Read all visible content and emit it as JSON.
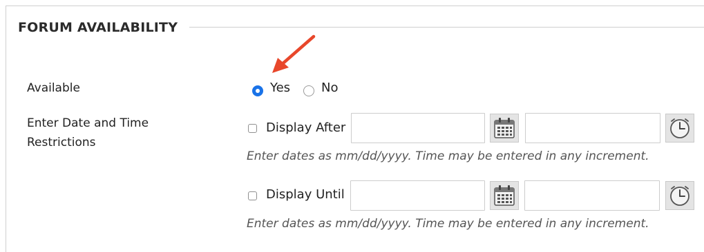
{
  "section": {
    "title": "FORUM AVAILABILITY"
  },
  "available": {
    "label": "Available",
    "options": [
      {
        "label": "Yes",
        "selected": true
      },
      {
        "label": "No",
        "selected": false
      }
    ]
  },
  "restrictions": {
    "label_line1": "Enter Date and Time",
    "label_line2": "Restrictions",
    "display_after": {
      "label": "Display After",
      "checked": false,
      "date_value": "",
      "time_value": "",
      "hint": "Enter dates as mm/dd/yyyy. Time may be entered in any increment."
    },
    "display_until": {
      "label": "Display Until",
      "checked": false,
      "date_value": "",
      "time_value": "",
      "hint": "Enter dates as mm/dd/yyyy. Time may be entered in any increment."
    }
  },
  "icons": {
    "date_picker": "calendar-icon",
    "time_picker": "clock-icon",
    "annotation": "red-arrow-icon"
  },
  "colors": {
    "radio_selected": "#1a73e8",
    "annotation_arrow": "#e8472b",
    "icon_button_bg": "#e4e4e4"
  }
}
